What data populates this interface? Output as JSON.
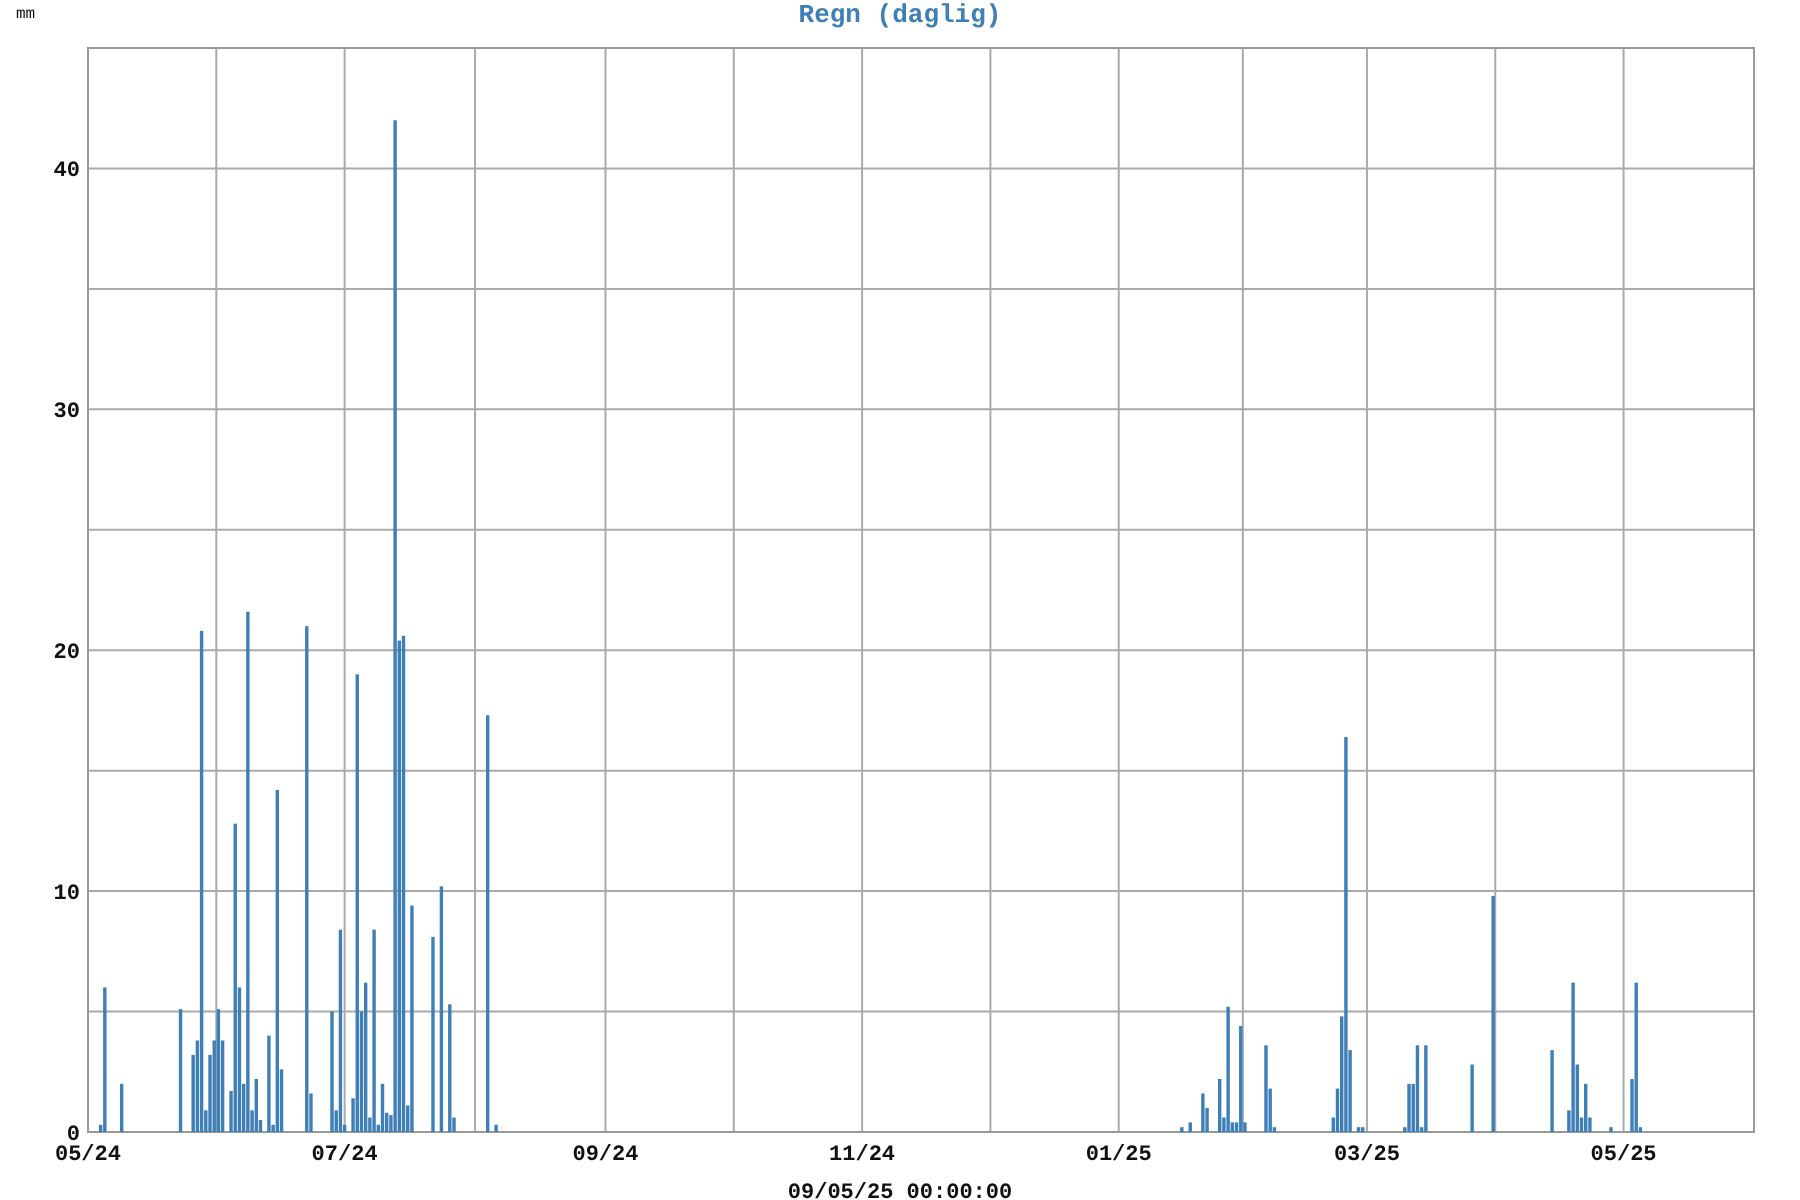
{
  "chart": {
    "chart_data": {
      "type": "bar",
      "title": "Regn (daglig)",
      "xlabel": "09/05/25 00:00:00",
      "ylabel": "mm",
      "categories": [
        "05/24",
        null,
        null,
        null,
        null,
        null,
        null,
        null,
        null,
        null,
        null,
        null,
        null,
        null,
        null,
        null,
        null,
        null,
        null,
        null,
        null,
        null,
        null,
        null,
        null,
        null,
        null,
        null,
        null,
        null,
        null,
        null,
        null,
        null,
        null,
        null,
        null,
        null,
        null,
        null,
        null,
        null,
        null,
        null,
        null,
        null,
        null,
        null,
        null,
        null,
        null,
        null,
        null,
        null,
        null,
        null,
        null,
        null,
        null,
        null,
        null,
        "07/24",
        null,
        null,
        null,
        null,
        null,
        null,
        null,
        null,
        null,
        null,
        null,
        null,
        null,
        null,
        null,
        null,
        null,
        null,
        null,
        null,
        null,
        null,
        null,
        null,
        null,
        null,
        null,
        null,
        null,
        null,
        null,
        null,
        null,
        null,
        null,
        null,
        null,
        null,
        null,
        null,
        null,
        null,
        null,
        null,
        null,
        null,
        null,
        null,
        null,
        null,
        null,
        null,
        null,
        null,
        null,
        null,
        null,
        null,
        null,
        null,
        null,
        "09/24",
        null,
        null,
        null,
        null,
        null,
        null,
        null,
        null,
        null,
        null,
        null,
        null,
        null,
        null,
        null,
        null,
        null,
        null,
        null,
        null,
        null,
        null,
        null,
        null,
        null,
        null,
        null,
        null,
        null,
        null,
        null,
        null,
        null,
        null,
        null,
        null,
        null,
        null,
        null,
        null,
        null,
        null,
        null,
        null,
        null,
        null,
        null,
        null,
        null,
        null,
        null,
        null,
        null,
        null,
        null,
        null,
        null,
        null,
        null,
        null,
        "11/24",
        null,
        null,
        null,
        null,
        null,
        null,
        null,
        null,
        null,
        null,
        null,
        null,
        null,
        null,
        null,
        null,
        null,
        null,
        null,
        null,
        null,
        null,
        null,
        null,
        null,
        null,
        null,
        null,
        null,
        null,
        null,
        null,
        null,
        null,
        null,
        null,
        null,
        null,
        null,
        null,
        null,
        null,
        null,
        null,
        null,
        null,
        null,
        null,
        null,
        null,
        null,
        null,
        null,
        null,
        null,
        null,
        null,
        null,
        null,
        null,
        "01/25",
        null,
        null,
        null,
        null,
        null,
        null,
        null,
        null,
        null,
        null,
        null,
        null,
        null,
        null,
        null,
        null,
        null,
        null,
        null,
        null,
        null,
        null,
        null,
        null,
        null,
        null,
        null,
        null,
        null,
        null,
        null,
        null,
        null,
        null,
        null,
        null,
        null,
        null,
        null,
        null,
        null,
        null,
        null,
        null,
        null,
        null,
        null,
        null,
        null,
        null,
        null,
        null,
        null,
        null,
        null,
        null,
        null,
        null,
        "03/25",
        null,
        null,
        null,
        null,
        null,
        null,
        null,
        null,
        null,
        null,
        null,
        null,
        null,
        null,
        null,
        null,
        null,
        null,
        null,
        null,
        null,
        null,
        null,
        null,
        null,
        null,
        null,
        null,
        null,
        null,
        null,
        null,
        null,
        null,
        null,
        null,
        null,
        null,
        null,
        null,
        null,
        null,
        null,
        null,
        null,
        null,
        null,
        null,
        null,
        null,
        null,
        null,
        null,
        null,
        null,
        null,
        null,
        null,
        null,
        null,
        "05/25",
        null,
        null,
        null,
        null,
        null,
        null,
        null,
        null,
        null,
        null,
        null,
        null,
        null,
        null,
        null,
        null,
        null,
        null,
        null,
        null,
        null,
        null,
        null,
        null,
        null,
        null,
        null,
        null,
        null,
        null
      ],
      "series": [
        {
          "color": "#3f7fb7",
          "values": [
            null,
            null,
            null,
            0.3,
            6.0,
            null,
            null,
            null,
            2.0,
            null,
            null,
            null,
            null,
            null,
            null,
            null,
            null,
            null,
            null,
            null,
            null,
            null,
            5.1,
            null,
            null,
            3.2,
            3.8,
            20.8,
            0.9,
            3.2,
            3.8,
            5.1,
            3.8,
            null,
            1.7,
            12.8,
            6.0,
            2.0,
            21.6,
            0.9,
            2.2,
            0.5,
            null,
            4.0,
            0.3,
            14.2,
            2.6,
            null,
            null,
            null,
            null,
            null,
            21.0,
            1.6,
            null,
            null,
            null,
            null,
            5.0,
            0.9,
            8.4,
            0.3,
            null,
            1.4,
            19.0,
            5.0,
            6.2,
            0.6,
            8.4,
            0.3,
            2.0,
            0.8,
            0.7,
            42.0,
            20.4,
            20.6,
            1.1,
            9.4,
            null,
            null,
            null,
            null,
            8.1,
            null,
            10.2,
            null,
            5.3,
            0.6,
            null,
            null,
            null,
            null,
            null,
            null,
            null,
            17.3,
            null,
            0.3,
            null,
            null,
            null,
            null,
            null,
            null,
            null,
            null,
            null,
            null,
            null,
            null,
            null,
            null,
            null,
            null,
            null,
            null,
            null,
            null,
            null,
            null,
            null,
            null,
            null,
            null,
            null,
            null,
            null,
            null,
            null,
            null,
            null,
            null,
            null,
            null,
            null,
            null,
            null,
            null,
            null,
            null,
            null,
            null,
            null,
            null,
            null,
            null,
            null,
            null,
            null,
            null,
            null,
            null,
            null,
            null,
            null,
            null,
            null,
            null,
            null,
            null,
            null,
            null,
            null,
            null,
            null,
            null,
            null,
            null,
            null,
            null,
            null,
            null,
            null,
            null,
            null,
            null,
            null,
            null,
            null,
            null,
            null,
            null,
            null,
            null,
            null,
            null,
            null,
            null,
            null,
            null,
            null,
            null,
            null,
            null,
            null,
            null,
            null,
            null,
            null,
            null,
            null,
            null,
            null,
            null,
            null,
            null,
            null,
            null,
            null,
            null,
            null,
            null,
            null,
            null,
            null,
            null,
            null,
            null,
            null,
            null,
            null,
            null,
            null,
            null,
            null,
            null,
            null,
            null,
            null,
            null,
            null,
            null,
            null,
            null,
            null,
            null,
            null,
            null,
            null,
            null,
            null,
            null,
            null,
            null,
            null,
            null,
            null,
            null,
            null,
            null,
            null,
            null,
            null,
            null,
            null,
            null,
            null,
            null,
            null,
            null,
            0.2,
            null,
            0.4,
            null,
            null,
            1.6,
            1.0,
            null,
            null,
            2.2,
            0.6,
            5.2,
            0.4,
            0.4,
            4.4,
            0.4,
            null,
            null,
            null,
            null,
            3.6,
            1.8,
            0.2,
            null,
            null,
            null,
            null,
            null,
            null,
            null,
            null,
            null,
            null,
            null,
            null,
            null,
            0.6,
            1.8,
            4.8,
            16.4,
            3.4,
            null,
            0.2,
            0.2,
            null,
            null,
            null,
            null,
            null,
            null,
            null,
            null,
            null,
            0.2,
            2.0,
            2.0,
            3.6,
            0.2,
            3.6,
            null,
            null,
            null,
            null,
            null,
            null,
            null,
            null,
            null,
            null,
            2.8,
            null,
            null,
            null,
            null,
            9.8,
            null,
            null,
            null,
            null,
            null,
            null,
            null,
            null,
            null,
            null,
            null,
            null,
            null,
            3.4,
            null,
            null,
            null,
            0.9,
            6.2,
            2.8,
            0.6,
            2.0,
            0.6,
            null,
            null,
            null,
            null,
            0.2,
            null,
            null,
            null,
            null,
            2.2,
            6.2,
            0.2,
            null,
            null,
            null,
            null,
            null,
            null,
            null,
            null,
            null,
            null,
            null,
            null,
            null,
            null,
            null,
            null,
            null,
            null,
            null,
            null,
            null,
            null,
            null,
            null,
            null,
            null
          ]
        }
      ],
      "grid": true,
      "ylim": [
        0,
        45
      ],
      "yticks": [
        0,
        10,
        20,
        30,
        40
      ]
    }
  }
}
